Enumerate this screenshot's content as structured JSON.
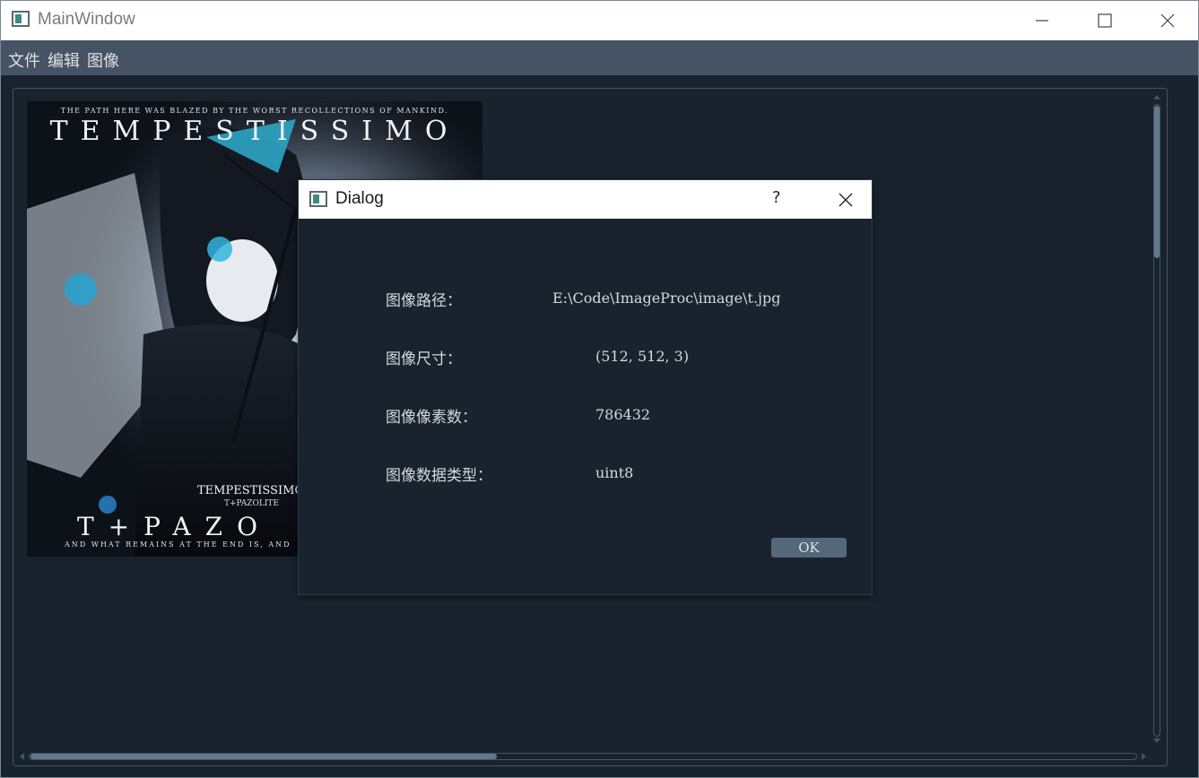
{
  "window": {
    "title": "MainWindow"
  },
  "menubar": {
    "items": [
      "文件",
      "编辑",
      "图像"
    ]
  },
  "image": {
    "top_caption": "THE PATH HERE WAS BLAZED BY THE WORST RECOLLECTIONS OF MANKIND.",
    "title": "TEMPESTISSIMO",
    "subtitle": "TEMPESTISSIMO",
    "artist_small": "T+PAZOLITE",
    "artist_large": "T+PAZO",
    "bottom_caption": "AND WHAT REMAINS AT THE END IS, AND"
  },
  "dialog": {
    "title": "Dialog",
    "help": "?",
    "rows": [
      {
        "label": "图像路径：",
        "value": "E:\\Code\\ImageProc\\image\\t.jpg"
      },
      {
        "label": "图像尺寸：",
        "value": "(512, 512, 3)"
      },
      {
        "label": "图像像素数：",
        "value": "786432"
      },
      {
        "label": "图像数据类型：",
        "value": "uint8"
      }
    ],
    "ok_label": "OK"
  },
  "colors": {
    "background": "#19232d",
    "menubar": "#455364",
    "scroll_thumb": "#60798b",
    "button": "#54687a"
  }
}
